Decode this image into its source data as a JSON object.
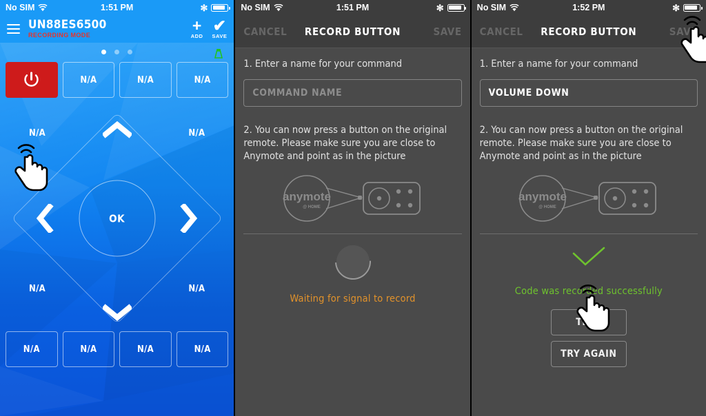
{
  "screens": [
    {
      "id": "remote-screen",
      "status_bar": {
        "carrier": "No SIM",
        "time": "1:51 PM",
        "wifi_icon": "wifi-icon",
        "bluetooth_icon": "bluetooth-icon",
        "battery_icon": "battery-icon"
      },
      "header": {
        "menu_icon": "hamburger-menu-icon",
        "device_name": "UN88ES6500",
        "mode_label": "RECORDING MODE",
        "add_icon": "plus-icon",
        "add_label": "ADD",
        "save_icon": "checkmark-icon",
        "save_label": "SAVE"
      },
      "pager": {
        "count": 3,
        "active": 0
      },
      "ir_icon": "ir-blaster-icon",
      "top_row": [
        {
          "label": "",
          "icon": "power-icon",
          "type": "power"
        },
        {
          "label": "N/A",
          "type": "empty"
        },
        {
          "label": "N/A",
          "type": "empty"
        },
        {
          "label": "N/A",
          "type": "empty"
        }
      ],
      "dpad": {
        "ok_label": "OK",
        "up_icon": "chevron-up-icon",
        "down_icon": "chevron-down-icon",
        "left_icon": "chevron-left-icon",
        "right_icon": "chevron-right-icon",
        "corners": {
          "top_left": "N/A",
          "top_right": "N/A",
          "bottom_left": "N/A",
          "bottom_right": "N/A"
        }
      },
      "bottom_row": [
        {
          "label": "N/A"
        },
        {
          "label": "N/A"
        },
        {
          "label": "N/A"
        },
        {
          "label": "N/A"
        }
      ],
      "cursor": {
        "icon": "tap-hand-cursor",
        "target": "top-left-na-button"
      }
    },
    {
      "id": "record-waiting-screen",
      "status_bar": {
        "carrier": "No SIM",
        "time": "1:51 PM",
        "wifi_icon": "wifi-icon",
        "bluetooth_icon": "bluetooth-icon",
        "battery_icon": "battery-icon"
      },
      "navbar": {
        "cancel_label": "CANCEL",
        "title": "RECORD BUTTON",
        "save_label": "SAVE"
      },
      "step1_text": "1. Enter a name for your command",
      "name_input": {
        "value": "",
        "placeholder": "COMMAND NAME"
      },
      "step2_text": "2. You can now press a button on the original remote. Please make sure you are close to Anymote and point as in the picture",
      "illustration": {
        "logo_main": "anymote",
        "logo_sub": "@ HOME",
        "icon": "anymote-pointing-remote-diagram"
      },
      "state": {
        "indicator": "loading-spinner",
        "message": "Waiting for signal to record",
        "color": "#e2922b"
      }
    },
    {
      "id": "record-success-screen",
      "status_bar": {
        "carrier": "No SIM",
        "time": "1:52 PM",
        "wifi_icon": "wifi-icon",
        "bluetooth_icon": "bluetooth-icon",
        "battery_icon": "battery-icon"
      },
      "navbar": {
        "cancel_label": "CANCEL",
        "title": "RECORD BUTTON",
        "save_label": "SAVE"
      },
      "step1_text": "1. Enter a name for your command",
      "name_input": {
        "value": "VOLUME DOWN",
        "placeholder": "COMMAND NAME"
      },
      "step2_text": "2. You can now press a button on the original remote. Please make sure you are close to Anymote and point as in the picture",
      "illustration": {
        "logo_main": "anymote",
        "logo_sub": "@ HOME",
        "icon": "anymote-pointing-remote-diagram"
      },
      "state": {
        "indicator": "success-checkmark",
        "message": "Code was recorded successfully",
        "color": "#6ec22e"
      },
      "buttons": [
        {
          "label": "TEST",
          "name": "test-button"
        },
        {
          "label": "TRY AGAIN",
          "name": "try-again-button"
        }
      ],
      "cursors": [
        {
          "icon": "tap-hand-cursor",
          "target": "save-button"
        },
        {
          "icon": "tap-hand-cursor",
          "target": "test-button"
        }
      ]
    }
  ],
  "colors": {
    "remote_blue": "#0f8ff5",
    "remote_blue_dark": "#0a53d8",
    "power_red": "#ce1b1b",
    "recording_red": "#e8332a",
    "dark_bg": "#4a4a4a",
    "nav_bg": "#3d3d3d",
    "waiting_orange": "#e2922b",
    "success_green": "#6ec22e",
    "ir_green": "#22c322"
  }
}
